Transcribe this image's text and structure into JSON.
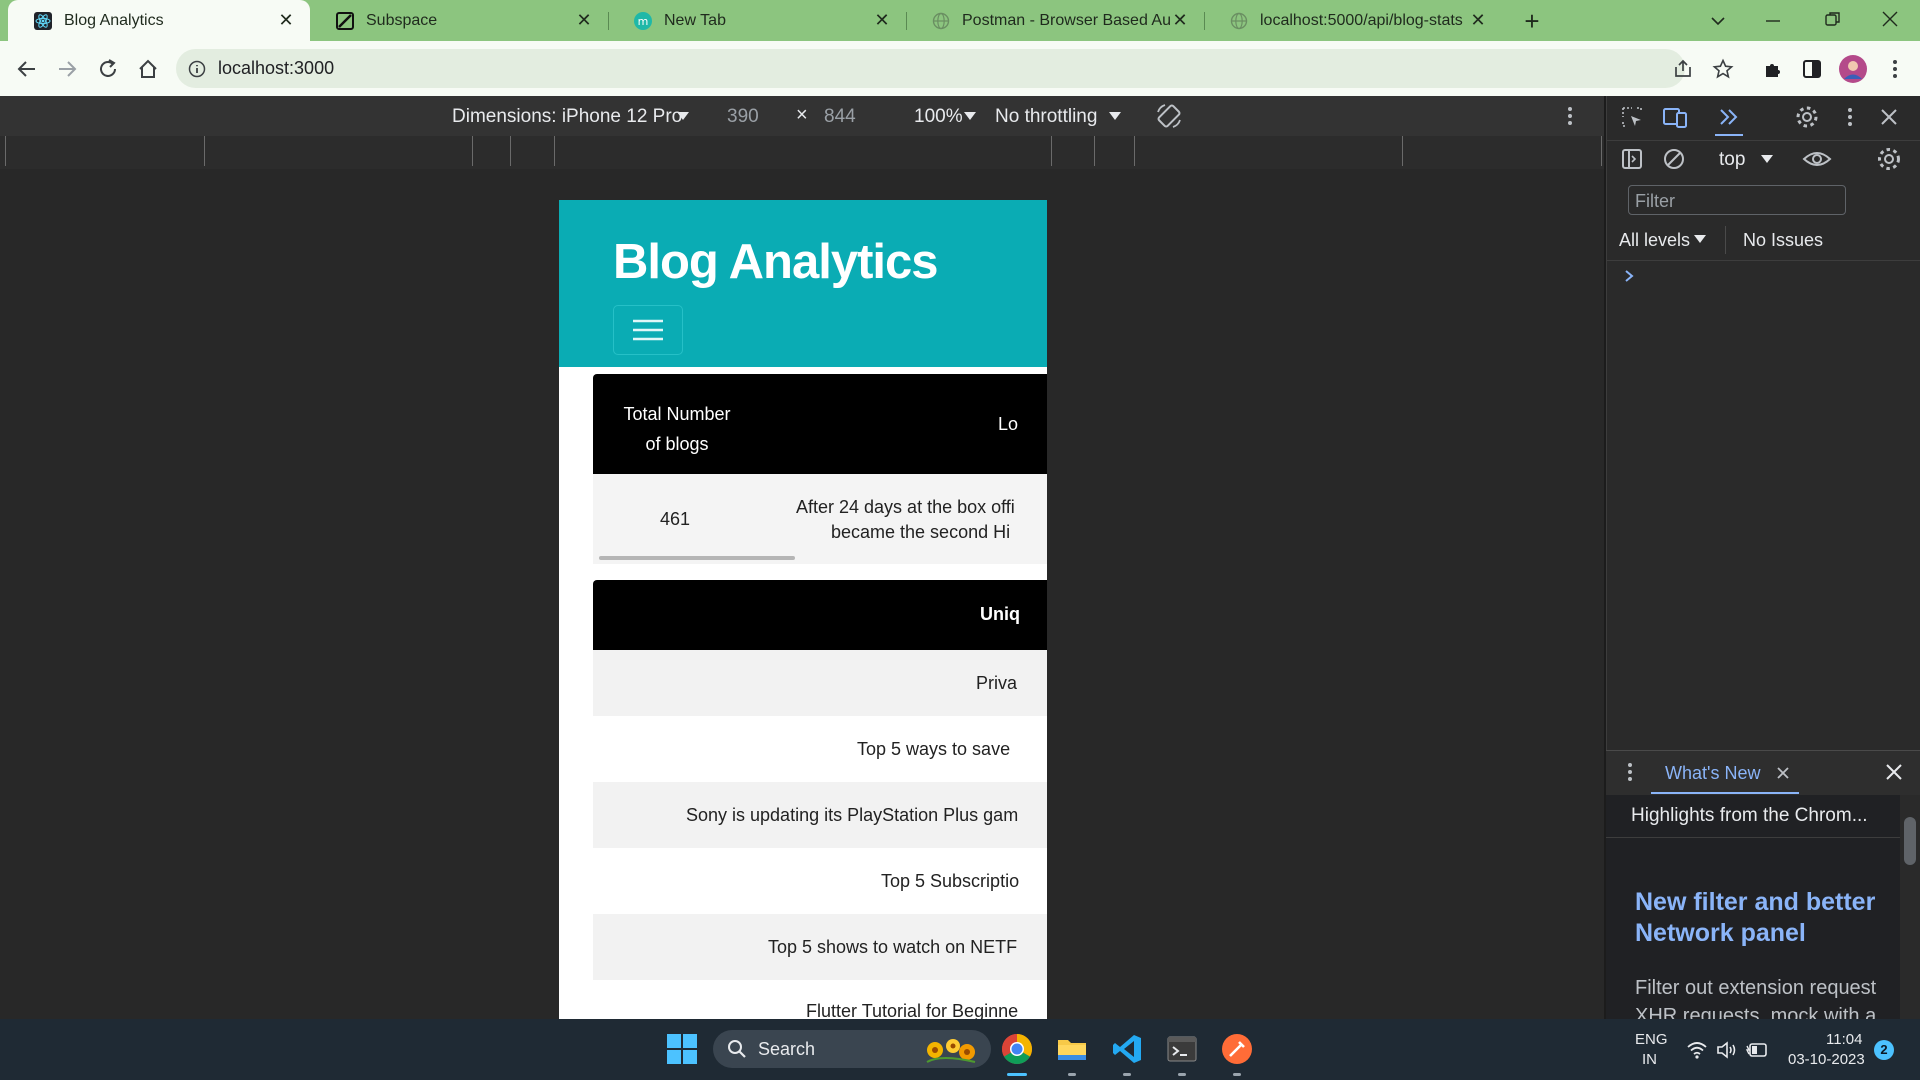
{
  "browser": {
    "tabs": [
      {
        "title": "Blog Analytics",
        "icon": "react-icon",
        "active": true
      },
      {
        "title": "Subspace",
        "icon": "subspace-icon",
        "active": false
      },
      {
        "title": "New Tab",
        "icon": "m-icon",
        "active": false
      },
      {
        "title": "Postman - Browser Based Auth",
        "icon": "globe-icon",
        "active": false
      },
      {
        "title": "localhost:5000/api/blog-stats",
        "icon": "globe-icon",
        "active": false
      }
    ],
    "url": "localhost:3000",
    "accent_color": "#8cc57f"
  },
  "device_toolbar": {
    "dimensions_label": "Dimensions: iPhone 12 Pro",
    "width": "390",
    "height": "844",
    "zoom": "100%",
    "throttling": "No throttling"
  },
  "app": {
    "title": "Blog Analytics",
    "header_color": "#0aacb4",
    "stats_table": {
      "headers": [
        "Total Number of blogs",
        "Lo"
      ],
      "header_line1": "Total Number",
      "header_line2": "of blogs",
      "row": {
        "count": "461",
        "longest_line1": "After 24 days at the box offi",
        "longest_line2": "became the second Hi"
      }
    },
    "unique_table": {
      "header": "Uniq",
      "rows": [
        "Priva",
        "Top 5 ways to save",
        "Sony is updating its PlayStation Plus gam",
        "Top 5 Subscriptio",
        "Top 5 shows to watch on NETF",
        "Flutter Tutorial for Beginne"
      ]
    }
  },
  "devtools": {
    "context": "top",
    "filter_placeholder": "Filter",
    "levels": "All levels",
    "issues": "No Issues",
    "drawer": {
      "tab": "What's New",
      "highlights": "Highlights from the Chrom...",
      "headline_line1": "New filter and better",
      "headline_line2": "Network panel",
      "body_line1": "Filter out extension request",
      "body_line2": "XHR requests, mock with a"
    }
  },
  "taskbar": {
    "search_label": "Search",
    "lang_line1": "ENG",
    "lang_line2": "IN",
    "time": "11:04",
    "date": "03-10-2023",
    "notification_count": "2"
  }
}
